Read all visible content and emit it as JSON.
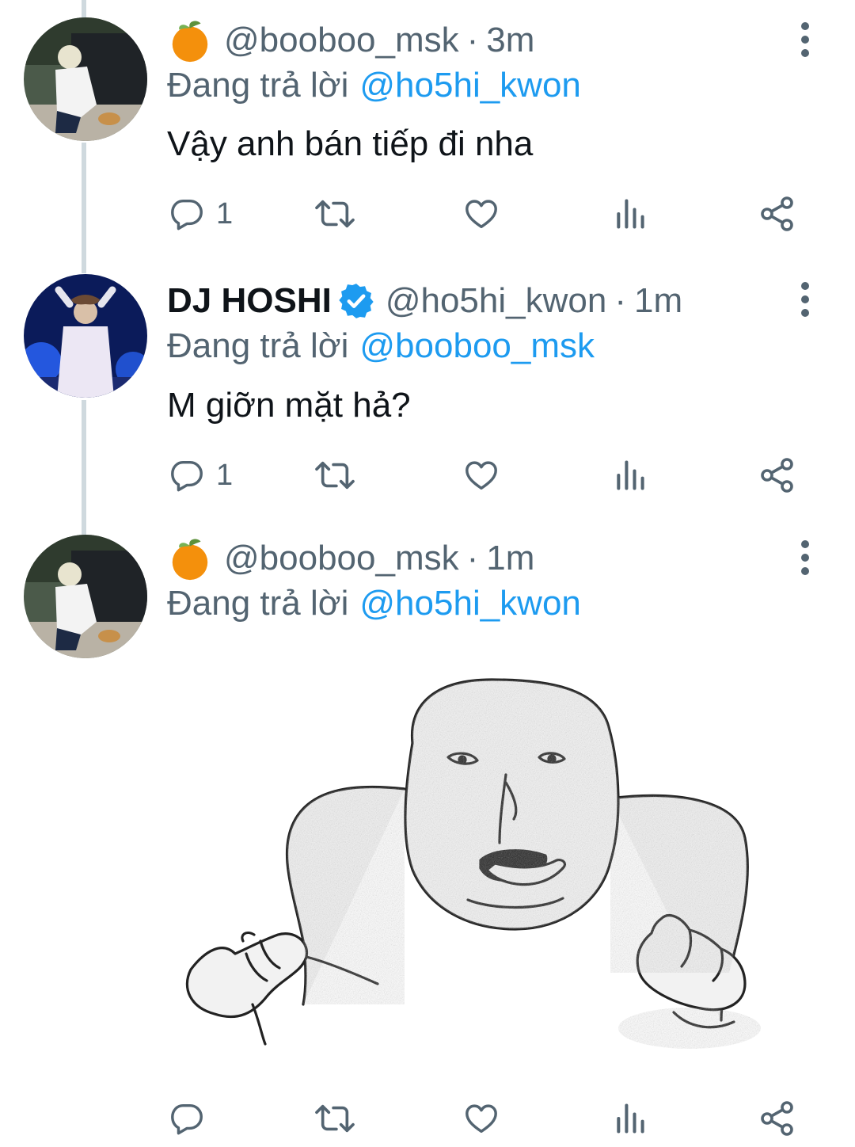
{
  "tweets": [
    {
      "emoji": "tangerine-emoji",
      "name": "",
      "handle": "@booboo_msk",
      "sep": "·",
      "time": "3m",
      "reply_prefix": "Đang trả lời",
      "reply_to": "@ho5hi_kwon",
      "text": "Vậy anh bán tiếp đi nha",
      "reply_count": "1"
    },
    {
      "emoji": "",
      "name": "DJ HOSHI",
      "verified": true,
      "handle": "@ho5hi_kwon",
      "sep": "·",
      "time": "1m",
      "reply_prefix": "Đang trả lời",
      "reply_to": "@booboo_msk",
      "text": "M giỡn mặt hả?",
      "reply_count": "1"
    },
    {
      "emoji": "tangerine-emoji",
      "name": "",
      "handle": "@booboo_msk",
      "sep": "·",
      "time": "1m",
      "reply_prefix": "Đang trả lời",
      "reply_to": "@ho5hi_kwon",
      "text": "",
      "reply_count": "",
      "media": "meme-drawing"
    }
  ],
  "colors": {
    "mention": "#1d9bf0",
    "secondary_text": "#536471",
    "thread_line": "#cfd9de",
    "verified": "#1d9bf0"
  },
  "icons": {
    "reply": "reply-icon",
    "retweet": "retweet-icon",
    "like": "heart-icon",
    "views": "views-icon",
    "share": "share-icon",
    "more": "more-icon"
  }
}
